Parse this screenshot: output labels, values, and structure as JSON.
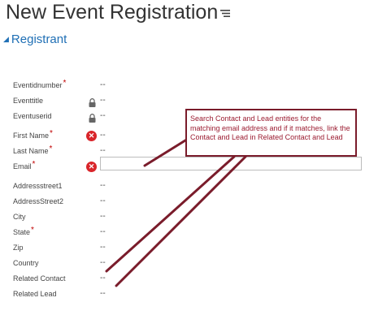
{
  "page": {
    "title": "New Event Registration"
  },
  "section": {
    "title": "Registrant"
  },
  "fields": [
    {
      "label": "Eventidnumber",
      "required": true,
      "locked": false,
      "error": false,
      "value": "--"
    },
    {
      "label": "Eventtitle",
      "required": false,
      "locked": true,
      "error": false,
      "value": "--"
    },
    {
      "label": "Eventuserid",
      "required": false,
      "locked": true,
      "error": false,
      "value": "--"
    },
    {
      "label": "First Name",
      "required": true,
      "locked": false,
      "error": true,
      "value": "--"
    },
    {
      "label": "Last Name",
      "required": true,
      "locked": false,
      "error": false,
      "value": "--"
    },
    {
      "label": "Email",
      "required": true,
      "locked": false,
      "error": true,
      "value": ""
    },
    {
      "label": "Addressstreet1",
      "required": false,
      "locked": false,
      "error": false,
      "value": "--"
    },
    {
      "label": "AddressStreet2",
      "required": false,
      "locked": false,
      "error": false,
      "value": "--"
    },
    {
      "label": "City",
      "required": false,
      "locked": false,
      "error": false,
      "value": "--"
    },
    {
      "label": "State",
      "required": true,
      "locked": false,
      "error": false,
      "value": "--"
    },
    {
      "label": "Zip",
      "required": false,
      "locked": false,
      "error": false,
      "value": "--"
    },
    {
      "label": "Country",
      "required": false,
      "locked": false,
      "error": false,
      "value": "--"
    },
    {
      "label": "Related Contact",
      "required": false,
      "locked": false,
      "error": false,
      "value": "--"
    },
    {
      "label": "Related Lead",
      "required": false,
      "locked": false,
      "error": false,
      "value": "--"
    }
  ],
  "callout": {
    "text": "Search Contact and Lead entities for the matching email address and if it matches, link the Contact and Lead in Related Contact and Lead"
  },
  "icons": {
    "menu": "menu-icon",
    "lock": "lock-icon",
    "error": "error-x-icon",
    "collapse": "collapse-triangle-icon"
  },
  "colors": {
    "section": "#1f6fb5",
    "required": "#c00000",
    "error": "#d9252a",
    "callout_border": "#7a1c2b",
    "callout_text": "#9b1b30"
  }
}
